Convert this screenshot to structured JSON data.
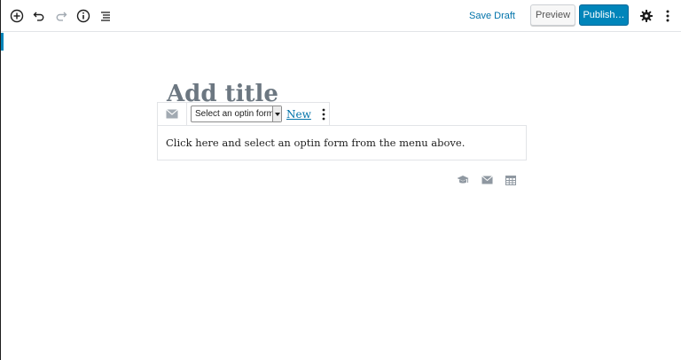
{
  "toolbar": {
    "icons": {
      "add": "plus-circle-icon",
      "undo": "undo-icon",
      "redo": "redo-icon",
      "info": "info-icon",
      "outline": "list-outline-icon",
      "settings": "gear-icon",
      "more": "vertical-ellipsis-icon"
    },
    "save_draft_label": "Save Draft",
    "preview_label": "Preview",
    "publish_label": "Publish…"
  },
  "editor": {
    "title_placeholder": "Add title",
    "block": {
      "icon": "envelope-icon",
      "select_value": "Select an optin form",
      "new_link_label": "New",
      "more_icon": "vertical-ellipsis-icon",
      "body_text": "Click here and select an optin form from the menu above."
    },
    "inserter_shortcuts": [
      {
        "icon": "graduation-cap-icon"
      },
      {
        "icon": "envelope-icon"
      },
      {
        "icon": "table-icon"
      }
    ]
  },
  "colors": {
    "accent": "#0085ba",
    "link": "#0073aa",
    "icon": "#555d66",
    "muted_icon": "#8f98a1"
  }
}
